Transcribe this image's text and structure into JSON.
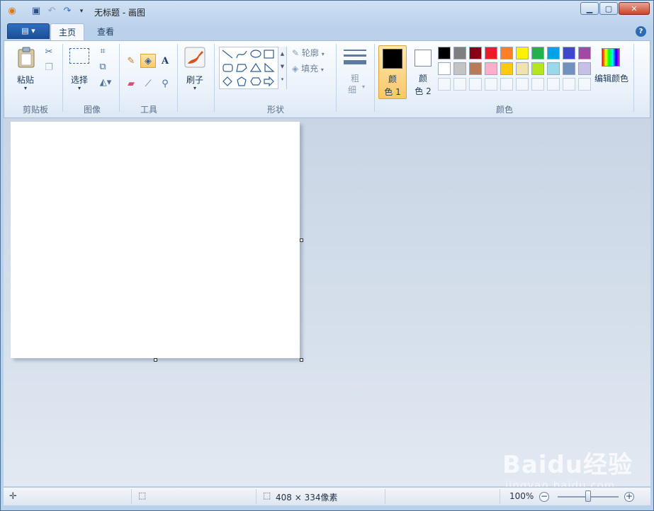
{
  "window": {
    "title": "无标题 - 画图",
    "controls": {
      "minimize": "▁",
      "maximize": "▢",
      "close": "✕"
    }
  },
  "quick_access": {
    "icons": [
      "paint-app-icon",
      "save-icon",
      "undo-icon",
      "redo-icon",
      "customize-dropdown-icon"
    ]
  },
  "ribbon": {
    "tabs": [
      {
        "label": "主页",
        "active": true
      },
      {
        "label": "查看",
        "active": false
      }
    ],
    "groups": {
      "clipboard": {
        "label": "剪贴板",
        "paste_label": "粘贴"
      },
      "image": {
        "label": "图像",
        "select_label": "选择"
      },
      "tools": {
        "label": "工具"
      },
      "brushes": {
        "label": "刷子"
      },
      "shapes": {
        "label": "形状",
        "outline_label": "轮廓",
        "fill_label": "填充"
      },
      "size": {
        "label_line1": "粗",
        "label_line2": "细"
      },
      "colors": {
        "label": "颜色",
        "color1_line1": "颜",
        "color1_line2": "色 1",
        "color2_line1": "颜",
        "color2_line2": "色 2",
        "edit_colors_label": "编辑颜色",
        "color1_value": "#000000",
        "color2_value": "#ffffff",
        "palette_row1": [
          "#000000",
          "#7f7f7f",
          "#880015",
          "#ed1c24",
          "#ff7f27",
          "#fff200",
          "#22b14c",
          "#00a2e8",
          "#3f48cc",
          "#a349a4"
        ],
        "palette_row2": [
          "#ffffff",
          "#c3c3c3",
          "#b97a57",
          "#ffaec9",
          "#ffc90e",
          "#efe4b0",
          "#b5e61d",
          "#99d9ea",
          "#7092be",
          "#c8bfe7"
        ]
      }
    }
  },
  "status": {
    "canvas_size": "408 × 334像素",
    "zoom": "100%"
  },
  "watermark": {
    "main": "Baidu经验",
    "sub": "jingyan.baidu.com"
  }
}
